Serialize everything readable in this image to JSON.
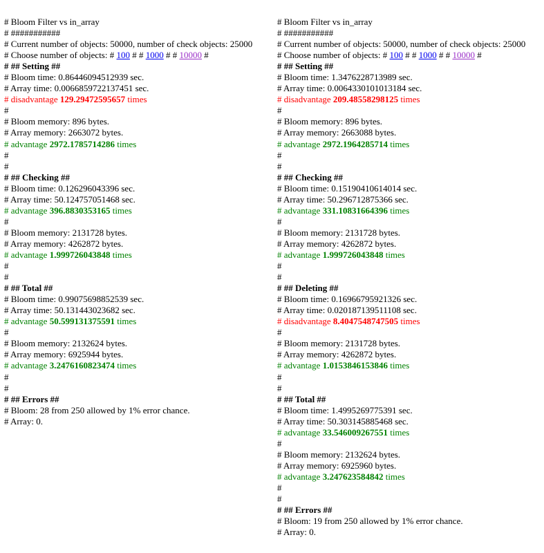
{
  "page": {
    "title": "# Bloom Filter vs in_array",
    "hash_rule": "# ###########",
    "current_objects_line": "# Current number of objects: 50000, number of check objects: 25000",
    "choose_prefix": "# Choose number of objects: #",
    "choose_options": [
      {
        "label": "100",
        "state": "unvisited"
      },
      {
        "label": "1000",
        "state": "unvisited"
      },
      {
        "label": "10000",
        "state": "visited"
      }
    ],
    "choose_separator": "# #",
    "choose_suffix": "#",
    "blank_line": "#",
    "colors": {
      "advantage": "#008000",
      "disadvantage": "#ff0000",
      "link": "#0000ee",
      "link_visited": "#9b30c8",
      "text": "#000000",
      "background": "#ffffff"
    }
  },
  "left": {
    "sections": [
      {
        "heading": "# ## Setting ##",
        "time_bloom": "# Bloom time: 0.86446094512939 sec.",
        "time_array": "# Array time: 0.0066859722137451 sec.",
        "time_verdict_kind": "disadvantage",
        "time_verdict_label": "disadvantage",
        "time_verdict_value": "129.29472595657",
        "time_verdict_unit": "times",
        "mem_bloom": "# Bloom memory: 896 bytes.",
        "mem_array": "# Array memory: 2663072 bytes.",
        "mem_verdict_kind": "advantage",
        "mem_verdict_label": "advantage",
        "mem_verdict_value": "2972.1785714286",
        "mem_verdict_unit": "times"
      },
      {
        "heading": "# ## Checking ##",
        "time_bloom": "# Bloom time: 0.126296043396 sec.",
        "time_array": "# Array time: 50.124757051468 sec.",
        "time_verdict_kind": "advantage",
        "time_verdict_label": "advantage",
        "time_verdict_value": "396.8830353165",
        "time_verdict_unit": "times",
        "mem_bloom": "# Bloom memory: 2131728 bytes.",
        "mem_array": "# Array memory: 4262872 bytes.",
        "mem_verdict_kind": "advantage",
        "mem_verdict_label": "advantage",
        "mem_verdict_value": "1.999726043848",
        "mem_verdict_unit": "times"
      },
      {
        "heading": "# ## Total ##",
        "time_bloom": "# Bloom time: 0.99075698852539 sec.",
        "time_array": "# Array time: 50.131443023682 sec.",
        "time_verdict_kind": "advantage",
        "time_verdict_label": "advantage",
        "time_verdict_value": "50.599131375591",
        "time_verdict_unit": "times",
        "mem_bloom": "# Bloom memory: 2132624 bytes.",
        "mem_array": "# Array memory: 6925944 bytes.",
        "mem_verdict_kind": "advantage",
        "mem_verdict_label": "advantage",
        "mem_verdict_value": "3.2476160823474",
        "mem_verdict_unit": "times"
      }
    ],
    "errors": {
      "heading": "# ## Errors ##",
      "bloom": "# Bloom: 28 from 250 allowed by 1% error chance.",
      "array": "# Array: 0."
    }
  },
  "right": {
    "sections": [
      {
        "heading": "# ## Setting ##",
        "time_bloom": "# Bloom time: 1.3476228713989 sec.",
        "time_array": "# Array time: 0.0064330101013184 sec.",
        "time_verdict_kind": "disadvantage",
        "time_verdict_label": "disadvantage",
        "time_verdict_value": "209.48558298125",
        "time_verdict_unit": "times",
        "mem_bloom": "# Bloom memory: 896 bytes.",
        "mem_array": "# Array memory: 2663088 bytes.",
        "mem_verdict_kind": "advantage",
        "mem_verdict_label": "advantage",
        "mem_verdict_value": "2972.1964285714",
        "mem_verdict_unit": "times"
      },
      {
        "heading": "# ## Checking ##",
        "time_bloom": "# Bloom time: 0.15190410614014 sec.",
        "time_array": "# Array time: 50.296712875366 sec.",
        "time_verdict_kind": "advantage",
        "time_verdict_label": "advantage",
        "time_verdict_value": "331.10831664396",
        "time_verdict_unit": "times",
        "mem_bloom": "# Bloom memory: 2131728 bytes.",
        "mem_array": "# Array memory: 4262872 bytes.",
        "mem_verdict_kind": "advantage",
        "mem_verdict_label": "advantage",
        "mem_verdict_value": "1.999726043848",
        "mem_verdict_unit": "times"
      },
      {
        "heading": "# ## Deleting ##",
        "time_bloom": "# Bloom time: 0.16966795921326 sec.",
        "time_array": "# Array time: 0.020187139511108 sec.",
        "time_verdict_kind": "disadvantage",
        "time_verdict_label": "disadvantage",
        "time_verdict_value": "8.4047548747505",
        "time_verdict_unit": "times",
        "mem_bloom": "# Bloom memory: 2131728 bytes.",
        "mem_array": "# Array memory: 4262872 bytes.",
        "mem_verdict_kind": "advantage",
        "mem_verdict_label": "advantage",
        "mem_verdict_value": "1.0153846153846",
        "mem_verdict_unit": "times"
      },
      {
        "heading": "# ## Total ##",
        "time_bloom": "# Bloom time: 1.4995269775391 sec.",
        "time_array": "# Array time: 50.303145885468 sec.",
        "time_verdict_kind": "advantage",
        "time_verdict_label": "advantage",
        "time_verdict_value": "33.546009267551",
        "time_verdict_unit": "times",
        "mem_bloom": "# Bloom memory: 2132624 bytes.",
        "mem_array": "# Array memory: 6925960 bytes.",
        "mem_verdict_kind": "advantage",
        "mem_verdict_label": "advantage",
        "mem_verdict_value": "3.247623584842",
        "mem_verdict_unit": "times"
      }
    ],
    "errors": {
      "heading": "# ## Errors ##",
      "bloom": "# Bloom: 19 from 250 allowed by 1% error chance.",
      "array": "# Array: 0."
    }
  }
}
